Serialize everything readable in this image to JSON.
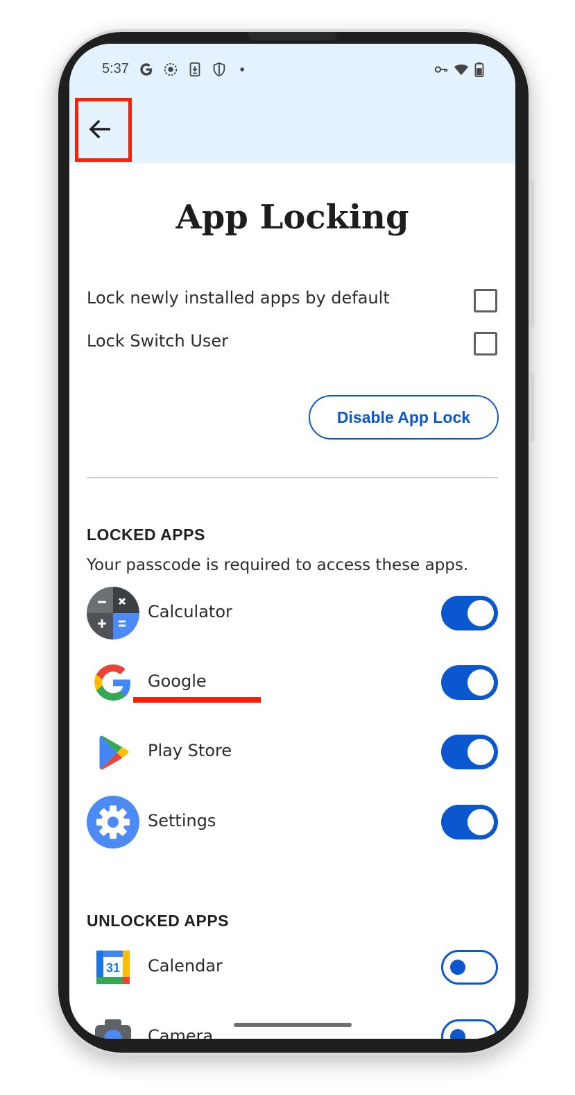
{
  "status_bar": {
    "time": "5:37",
    "left_icons": [
      "google-icon",
      "screen-record-icon",
      "download-icon",
      "shield-icon",
      "dot-icon"
    ],
    "right_icons": [
      "vpn-key-icon",
      "wifi-icon",
      "battery-icon"
    ]
  },
  "header": {
    "back_icon": "arrow-back-icon"
  },
  "page": {
    "title": "App Locking",
    "options": [
      {
        "label": "Lock newly installed apps by default",
        "checked": false
      },
      {
        "label": "Lock Switch User",
        "checked": false
      }
    ],
    "disable_button": "Disable App Lock"
  },
  "locked": {
    "title": "LOCKED APPS",
    "description": "Your passcode is required to access these apps.",
    "apps": [
      {
        "name": "Calculator",
        "icon": "calculator-icon",
        "locked": true
      },
      {
        "name": "Google",
        "icon": "google-icon",
        "locked": true
      },
      {
        "name": "Play Store",
        "icon": "play-store-icon",
        "locked": true
      },
      {
        "name": "Settings",
        "icon": "settings-icon",
        "locked": true
      }
    ]
  },
  "unlocked": {
    "title": "UNLOCKED APPS",
    "apps": [
      {
        "name": "Calendar",
        "icon": "calendar-icon",
        "calendar_day": "31",
        "locked": false
      },
      {
        "name": "Camera",
        "icon": "camera-icon",
        "locked": false
      }
    ]
  },
  "colors": {
    "accent": "#0b57d0",
    "header_bg": "#e3f2fd",
    "annotation_red": "#ff1e00"
  }
}
